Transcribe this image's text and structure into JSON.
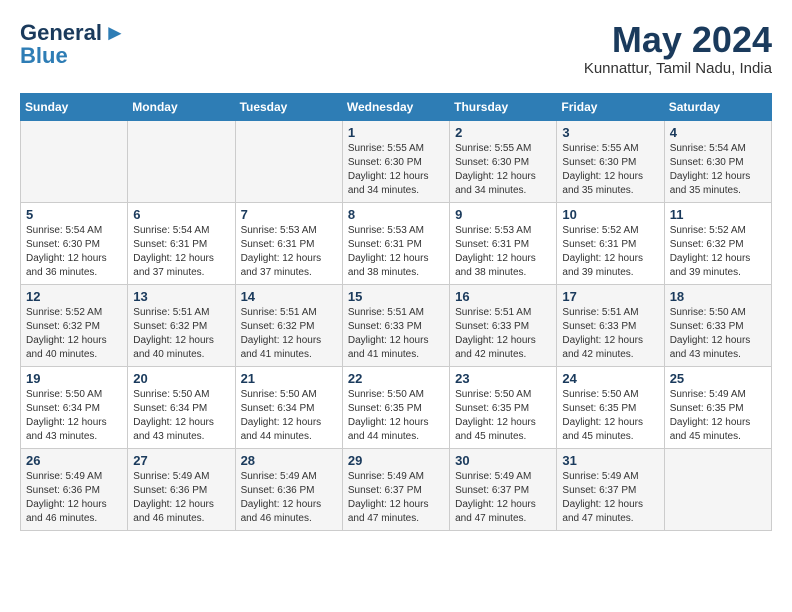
{
  "header": {
    "logo_general": "General",
    "logo_blue": "Blue",
    "month": "May 2024",
    "location": "Kunnattur, Tamil Nadu, India"
  },
  "days_of_week": [
    "Sunday",
    "Monday",
    "Tuesday",
    "Wednesday",
    "Thursday",
    "Friday",
    "Saturday"
  ],
  "weeks": [
    [
      {
        "day": "",
        "sunrise": "",
        "sunset": "",
        "daylight": ""
      },
      {
        "day": "",
        "sunrise": "",
        "sunset": "",
        "daylight": ""
      },
      {
        "day": "",
        "sunrise": "",
        "sunset": "",
        "daylight": ""
      },
      {
        "day": "1",
        "sunrise": "Sunrise: 5:55 AM",
        "sunset": "Sunset: 6:30 PM",
        "daylight": "Daylight: 12 hours and 34 minutes."
      },
      {
        "day": "2",
        "sunrise": "Sunrise: 5:55 AM",
        "sunset": "Sunset: 6:30 PM",
        "daylight": "Daylight: 12 hours and 34 minutes."
      },
      {
        "day": "3",
        "sunrise": "Sunrise: 5:55 AM",
        "sunset": "Sunset: 6:30 PM",
        "daylight": "Daylight: 12 hours and 35 minutes."
      },
      {
        "day": "4",
        "sunrise": "Sunrise: 5:54 AM",
        "sunset": "Sunset: 6:30 PM",
        "daylight": "Daylight: 12 hours and 35 minutes."
      }
    ],
    [
      {
        "day": "5",
        "sunrise": "Sunrise: 5:54 AM",
        "sunset": "Sunset: 6:30 PM",
        "daylight": "Daylight: 12 hours and 36 minutes."
      },
      {
        "day": "6",
        "sunrise": "Sunrise: 5:54 AM",
        "sunset": "Sunset: 6:31 PM",
        "daylight": "Daylight: 12 hours and 37 minutes."
      },
      {
        "day": "7",
        "sunrise": "Sunrise: 5:53 AM",
        "sunset": "Sunset: 6:31 PM",
        "daylight": "Daylight: 12 hours and 37 minutes."
      },
      {
        "day": "8",
        "sunrise": "Sunrise: 5:53 AM",
        "sunset": "Sunset: 6:31 PM",
        "daylight": "Daylight: 12 hours and 38 minutes."
      },
      {
        "day": "9",
        "sunrise": "Sunrise: 5:53 AM",
        "sunset": "Sunset: 6:31 PM",
        "daylight": "Daylight: 12 hours and 38 minutes."
      },
      {
        "day": "10",
        "sunrise": "Sunrise: 5:52 AM",
        "sunset": "Sunset: 6:31 PM",
        "daylight": "Daylight: 12 hours and 39 minutes."
      },
      {
        "day": "11",
        "sunrise": "Sunrise: 5:52 AM",
        "sunset": "Sunset: 6:32 PM",
        "daylight": "Daylight: 12 hours and 39 minutes."
      }
    ],
    [
      {
        "day": "12",
        "sunrise": "Sunrise: 5:52 AM",
        "sunset": "Sunset: 6:32 PM",
        "daylight": "Daylight: 12 hours and 40 minutes."
      },
      {
        "day": "13",
        "sunrise": "Sunrise: 5:51 AM",
        "sunset": "Sunset: 6:32 PM",
        "daylight": "Daylight: 12 hours and 40 minutes."
      },
      {
        "day": "14",
        "sunrise": "Sunrise: 5:51 AM",
        "sunset": "Sunset: 6:32 PM",
        "daylight": "Daylight: 12 hours and 41 minutes."
      },
      {
        "day": "15",
        "sunrise": "Sunrise: 5:51 AM",
        "sunset": "Sunset: 6:33 PM",
        "daylight": "Daylight: 12 hours and 41 minutes."
      },
      {
        "day": "16",
        "sunrise": "Sunrise: 5:51 AM",
        "sunset": "Sunset: 6:33 PM",
        "daylight": "Daylight: 12 hours and 42 minutes."
      },
      {
        "day": "17",
        "sunrise": "Sunrise: 5:51 AM",
        "sunset": "Sunset: 6:33 PM",
        "daylight": "Daylight: 12 hours and 42 minutes."
      },
      {
        "day": "18",
        "sunrise": "Sunrise: 5:50 AM",
        "sunset": "Sunset: 6:33 PM",
        "daylight": "Daylight: 12 hours and 43 minutes."
      }
    ],
    [
      {
        "day": "19",
        "sunrise": "Sunrise: 5:50 AM",
        "sunset": "Sunset: 6:34 PM",
        "daylight": "Daylight: 12 hours and 43 minutes."
      },
      {
        "day": "20",
        "sunrise": "Sunrise: 5:50 AM",
        "sunset": "Sunset: 6:34 PM",
        "daylight": "Daylight: 12 hours and 43 minutes."
      },
      {
        "day": "21",
        "sunrise": "Sunrise: 5:50 AM",
        "sunset": "Sunset: 6:34 PM",
        "daylight": "Daylight: 12 hours and 44 minutes."
      },
      {
        "day": "22",
        "sunrise": "Sunrise: 5:50 AM",
        "sunset": "Sunset: 6:35 PM",
        "daylight": "Daylight: 12 hours and 44 minutes."
      },
      {
        "day": "23",
        "sunrise": "Sunrise: 5:50 AM",
        "sunset": "Sunset: 6:35 PM",
        "daylight": "Daylight: 12 hours and 45 minutes."
      },
      {
        "day": "24",
        "sunrise": "Sunrise: 5:50 AM",
        "sunset": "Sunset: 6:35 PM",
        "daylight": "Daylight: 12 hours and 45 minutes."
      },
      {
        "day": "25",
        "sunrise": "Sunrise: 5:49 AM",
        "sunset": "Sunset: 6:35 PM",
        "daylight": "Daylight: 12 hours and 45 minutes."
      }
    ],
    [
      {
        "day": "26",
        "sunrise": "Sunrise: 5:49 AM",
        "sunset": "Sunset: 6:36 PM",
        "daylight": "Daylight: 12 hours and 46 minutes."
      },
      {
        "day": "27",
        "sunrise": "Sunrise: 5:49 AM",
        "sunset": "Sunset: 6:36 PM",
        "daylight": "Daylight: 12 hours and 46 minutes."
      },
      {
        "day": "28",
        "sunrise": "Sunrise: 5:49 AM",
        "sunset": "Sunset: 6:36 PM",
        "daylight": "Daylight: 12 hours and 46 minutes."
      },
      {
        "day": "29",
        "sunrise": "Sunrise: 5:49 AM",
        "sunset": "Sunset: 6:37 PM",
        "daylight": "Daylight: 12 hours and 47 minutes."
      },
      {
        "day": "30",
        "sunrise": "Sunrise: 5:49 AM",
        "sunset": "Sunset: 6:37 PM",
        "daylight": "Daylight: 12 hours and 47 minutes."
      },
      {
        "day": "31",
        "sunrise": "Sunrise: 5:49 AM",
        "sunset": "Sunset: 6:37 PM",
        "daylight": "Daylight: 12 hours and 47 minutes."
      },
      {
        "day": "",
        "sunrise": "",
        "sunset": "",
        "daylight": ""
      }
    ]
  ]
}
